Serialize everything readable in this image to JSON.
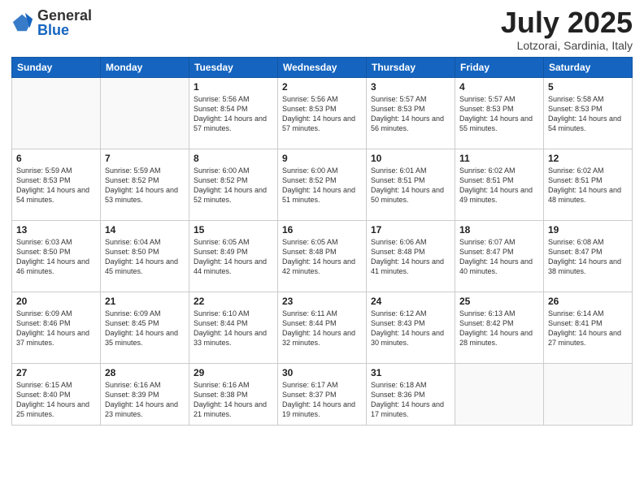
{
  "logo": {
    "general": "General",
    "blue": "Blue"
  },
  "header": {
    "month": "July 2025",
    "location": "Lotzorai, Sardinia, Italy"
  },
  "weekdays": [
    "Sunday",
    "Monday",
    "Tuesday",
    "Wednesday",
    "Thursday",
    "Friday",
    "Saturday"
  ],
  "weeks": [
    [
      {
        "day": "",
        "sunrise": "",
        "sunset": "",
        "daylight": ""
      },
      {
        "day": "",
        "sunrise": "",
        "sunset": "",
        "daylight": ""
      },
      {
        "day": "1",
        "sunrise": "Sunrise: 5:56 AM",
        "sunset": "Sunset: 8:54 PM",
        "daylight": "Daylight: 14 hours and 57 minutes."
      },
      {
        "day": "2",
        "sunrise": "Sunrise: 5:56 AM",
        "sunset": "Sunset: 8:53 PM",
        "daylight": "Daylight: 14 hours and 57 minutes."
      },
      {
        "day": "3",
        "sunrise": "Sunrise: 5:57 AM",
        "sunset": "Sunset: 8:53 PM",
        "daylight": "Daylight: 14 hours and 56 minutes."
      },
      {
        "day": "4",
        "sunrise": "Sunrise: 5:57 AM",
        "sunset": "Sunset: 8:53 PM",
        "daylight": "Daylight: 14 hours and 55 minutes."
      },
      {
        "day": "5",
        "sunrise": "Sunrise: 5:58 AM",
        "sunset": "Sunset: 8:53 PM",
        "daylight": "Daylight: 14 hours and 54 minutes."
      }
    ],
    [
      {
        "day": "6",
        "sunrise": "Sunrise: 5:59 AM",
        "sunset": "Sunset: 8:53 PM",
        "daylight": "Daylight: 14 hours and 54 minutes."
      },
      {
        "day": "7",
        "sunrise": "Sunrise: 5:59 AM",
        "sunset": "Sunset: 8:52 PM",
        "daylight": "Daylight: 14 hours and 53 minutes."
      },
      {
        "day": "8",
        "sunrise": "Sunrise: 6:00 AM",
        "sunset": "Sunset: 8:52 PM",
        "daylight": "Daylight: 14 hours and 52 minutes."
      },
      {
        "day": "9",
        "sunrise": "Sunrise: 6:00 AM",
        "sunset": "Sunset: 8:52 PM",
        "daylight": "Daylight: 14 hours and 51 minutes."
      },
      {
        "day": "10",
        "sunrise": "Sunrise: 6:01 AM",
        "sunset": "Sunset: 8:51 PM",
        "daylight": "Daylight: 14 hours and 50 minutes."
      },
      {
        "day": "11",
        "sunrise": "Sunrise: 6:02 AM",
        "sunset": "Sunset: 8:51 PM",
        "daylight": "Daylight: 14 hours and 49 minutes."
      },
      {
        "day": "12",
        "sunrise": "Sunrise: 6:02 AM",
        "sunset": "Sunset: 8:51 PM",
        "daylight": "Daylight: 14 hours and 48 minutes."
      }
    ],
    [
      {
        "day": "13",
        "sunrise": "Sunrise: 6:03 AM",
        "sunset": "Sunset: 8:50 PM",
        "daylight": "Daylight: 14 hours and 46 minutes."
      },
      {
        "day": "14",
        "sunrise": "Sunrise: 6:04 AM",
        "sunset": "Sunset: 8:50 PM",
        "daylight": "Daylight: 14 hours and 45 minutes."
      },
      {
        "day": "15",
        "sunrise": "Sunrise: 6:05 AM",
        "sunset": "Sunset: 8:49 PM",
        "daylight": "Daylight: 14 hours and 44 minutes."
      },
      {
        "day": "16",
        "sunrise": "Sunrise: 6:05 AM",
        "sunset": "Sunset: 8:48 PM",
        "daylight": "Daylight: 14 hours and 42 minutes."
      },
      {
        "day": "17",
        "sunrise": "Sunrise: 6:06 AM",
        "sunset": "Sunset: 8:48 PM",
        "daylight": "Daylight: 14 hours and 41 minutes."
      },
      {
        "day": "18",
        "sunrise": "Sunrise: 6:07 AM",
        "sunset": "Sunset: 8:47 PM",
        "daylight": "Daylight: 14 hours and 40 minutes."
      },
      {
        "day": "19",
        "sunrise": "Sunrise: 6:08 AM",
        "sunset": "Sunset: 8:47 PM",
        "daylight": "Daylight: 14 hours and 38 minutes."
      }
    ],
    [
      {
        "day": "20",
        "sunrise": "Sunrise: 6:09 AM",
        "sunset": "Sunset: 8:46 PM",
        "daylight": "Daylight: 14 hours and 37 minutes."
      },
      {
        "day": "21",
        "sunrise": "Sunrise: 6:09 AM",
        "sunset": "Sunset: 8:45 PM",
        "daylight": "Daylight: 14 hours and 35 minutes."
      },
      {
        "day": "22",
        "sunrise": "Sunrise: 6:10 AM",
        "sunset": "Sunset: 8:44 PM",
        "daylight": "Daylight: 14 hours and 33 minutes."
      },
      {
        "day": "23",
        "sunrise": "Sunrise: 6:11 AM",
        "sunset": "Sunset: 8:44 PM",
        "daylight": "Daylight: 14 hours and 32 minutes."
      },
      {
        "day": "24",
        "sunrise": "Sunrise: 6:12 AM",
        "sunset": "Sunset: 8:43 PM",
        "daylight": "Daylight: 14 hours and 30 minutes."
      },
      {
        "day": "25",
        "sunrise": "Sunrise: 6:13 AM",
        "sunset": "Sunset: 8:42 PM",
        "daylight": "Daylight: 14 hours and 28 minutes."
      },
      {
        "day": "26",
        "sunrise": "Sunrise: 6:14 AM",
        "sunset": "Sunset: 8:41 PM",
        "daylight": "Daylight: 14 hours and 27 minutes."
      }
    ],
    [
      {
        "day": "27",
        "sunrise": "Sunrise: 6:15 AM",
        "sunset": "Sunset: 8:40 PM",
        "daylight": "Daylight: 14 hours and 25 minutes."
      },
      {
        "day": "28",
        "sunrise": "Sunrise: 6:16 AM",
        "sunset": "Sunset: 8:39 PM",
        "daylight": "Daylight: 14 hours and 23 minutes."
      },
      {
        "day": "29",
        "sunrise": "Sunrise: 6:16 AM",
        "sunset": "Sunset: 8:38 PM",
        "daylight": "Daylight: 14 hours and 21 minutes."
      },
      {
        "day": "30",
        "sunrise": "Sunrise: 6:17 AM",
        "sunset": "Sunset: 8:37 PM",
        "daylight": "Daylight: 14 hours and 19 minutes."
      },
      {
        "day": "31",
        "sunrise": "Sunrise: 6:18 AM",
        "sunset": "Sunset: 8:36 PM",
        "daylight": "Daylight: 14 hours and 17 minutes."
      },
      {
        "day": "",
        "sunrise": "",
        "sunset": "",
        "daylight": ""
      },
      {
        "day": "",
        "sunrise": "",
        "sunset": "",
        "daylight": ""
      }
    ]
  ]
}
